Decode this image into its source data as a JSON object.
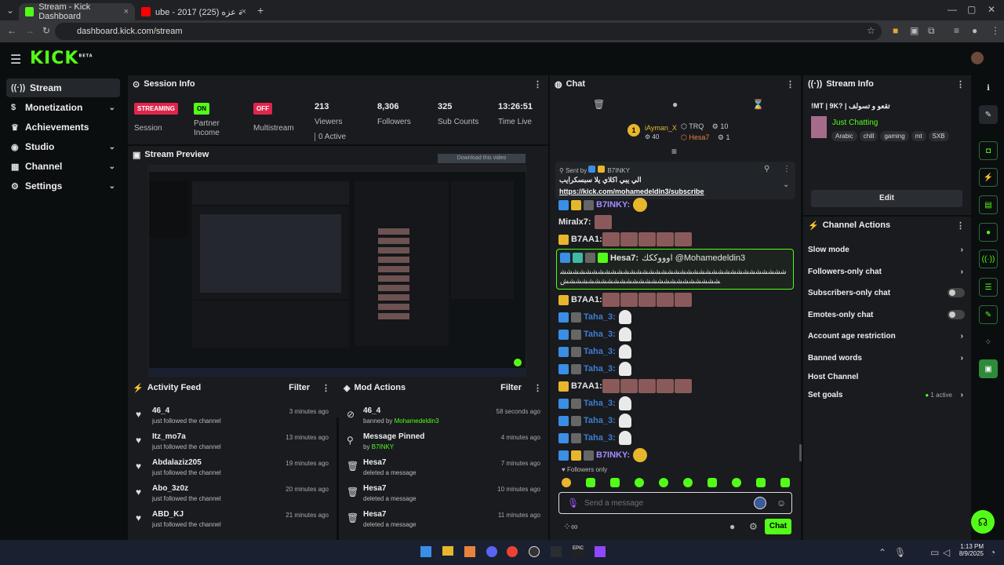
{
  "browser": {
    "tabs": [
      {
        "label": "Stream - Kick Dashboard"
      },
      {
        "label": "ube - 2017 شبلة عزه (225)"
      }
    ],
    "url": "dashboard.kick.com/stream"
  },
  "brand": {
    "logo": "KICK",
    "badge": "BETA",
    "accent": "#53fc18"
  },
  "sidebar": {
    "items": [
      {
        "label": "Stream",
        "icon": "radio-icon",
        "active": true
      },
      {
        "label": "Monetization",
        "icon": "dollar-icon"
      },
      {
        "label": "Achievements",
        "icon": "trophy-icon"
      },
      {
        "label": "Studio",
        "icon": "gamepad-icon"
      },
      {
        "label": "Channel",
        "icon": "grid-icon"
      },
      {
        "label": "Settings",
        "icon": "gear-icon"
      }
    ]
  },
  "session": {
    "title": "Session Info",
    "session_badge": "STREAMING",
    "session_label": "Session",
    "partner_badge": "ON",
    "partner_label": "Partner Income",
    "multistream_badge": "OFF",
    "multistream_label": "Multistream",
    "stats": [
      {
        "value": "213",
        "label": "Viewers",
        "extra": "0 Active"
      },
      {
        "value": "8,306",
        "label": "Followers"
      },
      {
        "value": "325",
        "label": "Sub Counts"
      },
      {
        "value": "13:26:51",
        "label": "Time Live"
      }
    ]
  },
  "preview": {
    "title": "Stream Preview",
    "download": "Download this video"
  },
  "activity": {
    "title": "Activity Feed",
    "filter": "Filter",
    "items": [
      {
        "name": "46_4",
        "sub": "just followed the channel",
        "time": "3 minutes ago"
      },
      {
        "name": "Itz_mo7a",
        "sub": "just followed the channel",
        "time": "13 minutes ago"
      },
      {
        "name": "Abdalaziz205",
        "sub": "just followed the channel",
        "time": "19 minutes ago"
      },
      {
        "name": "Abo_3z0z",
        "sub": "just followed the channel",
        "time": "20 minutes ago"
      },
      {
        "name": "ABD_KJ",
        "sub": "just followed the channel",
        "time": "21 minutes ago"
      }
    ]
  },
  "modactions": {
    "title": "Mod Actions",
    "filter": "Filter",
    "items": [
      {
        "name": "46_4",
        "sub_prefix": "banned by",
        "sub_user": "Mohamedeldin3",
        "time": "58 seconds ago",
        "icon": "ban-icon"
      },
      {
        "name": "Message Pinned",
        "sub_prefix": "by",
        "sub_user": "B7INKY",
        "time": "4 minutes ago",
        "icon": "pin-icon"
      },
      {
        "name": "Hesa7",
        "sub_prefix": "deleted a message",
        "sub_user": "",
        "time": "7 minutes ago",
        "icon": "trash-icon"
      },
      {
        "name": "Hesa7",
        "sub_prefix": "deleted a message",
        "sub_user": "",
        "time": "10 minutes ago",
        "icon": "trash-icon"
      },
      {
        "name": "Hesa7",
        "sub_prefix": "deleted a message",
        "sub_user": "",
        "time": "11 minutes ago",
        "icon": "trash-icon"
      }
    ]
  },
  "chat": {
    "title": "Chat",
    "leaderboard": [
      {
        "rank": "1",
        "name": "iAyman_X",
        "count": "40"
      },
      {
        "name": "TRQ",
        "count": "10"
      },
      {
        "name": "Hesa7",
        "count": "1"
      }
    ],
    "pinned": {
      "sent_by_label": "Sent by",
      "sent_by_user": "B7INKY",
      "text": "الي يبي اكلاي يلا سبسكرايب",
      "link": "https://kick.com/mohamedeldin3/subscribe"
    },
    "messages": [
      {
        "user": "B7INKY:",
        "color": "#a58cff"
      },
      {
        "user": "Miralx7:",
        "color": "#e6e6e6"
      },
      {
        "user": "B7AA1:",
        "color": "#e6e6e6"
      },
      {
        "user": "Hesa7:",
        "color": "#e6e6e6",
        "text": "اوووككك @Mohamedeldin3",
        "text2": "ششششششششششششششششششششششششششششششششششششششششششششششششششششششششششششش"
      },
      {
        "user": "B7AA1:",
        "color": "#e6e6e6"
      },
      {
        "user": "Taha_3:",
        "color": "#3f7dd1"
      },
      {
        "user": "Taha_3:",
        "color": "#3f7dd1"
      },
      {
        "user": "Taha_3:",
        "color": "#3f7dd1"
      },
      {
        "user": "Taha_3:",
        "color": "#3f7dd1"
      },
      {
        "user": "B7AA1:",
        "color": "#e6e6e6"
      },
      {
        "user": "Taha_3:",
        "color": "#3f7dd1"
      },
      {
        "user": "Taha_3:",
        "color": "#3f7dd1"
      },
      {
        "user": "Taha_3:",
        "color": "#3f7dd1"
      },
      {
        "user": "B7INKY:",
        "color": "#a58cff"
      }
    ],
    "followers_only": "Followers only",
    "input_placeholder": "Send a message",
    "send_label": "Chat"
  },
  "streaminfo": {
    "title": "Stream Info",
    "stream_title": "!MT | 9K? | تقعو و تسولف",
    "category": "Just Chatting",
    "tags": [
      "Arabic",
      "chill",
      "gaming",
      "mt",
      "SXB"
    ],
    "edit": "Edit"
  },
  "channel_actions": {
    "title": "Channel Actions",
    "items": [
      {
        "label": "Slow mode",
        "kind": "chevron"
      },
      {
        "label": "Followers-only chat",
        "kind": "chevron"
      },
      {
        "label": "Subscribers-only chat",
        "kind": "toggle"
      },
      {
        "label": "Emotes-only chat",
        "kind": "toggle"
      },
      {
        "label": "Account age restriction",
        "kind": "chevron"
      },
      {
        "label": "Banned words",
        "kind": "chevron"
      },
      {
        "label": "Host Channel",
        "kind": "none"
      },
      {
        "label": "Set goals",
        "kind": "chevron",
        "extra": "1 active"
      }
    ]
  },
  "taskbar": {
    "time": "1:13 PM",
    "date": "8/9/2025"
  }
}
